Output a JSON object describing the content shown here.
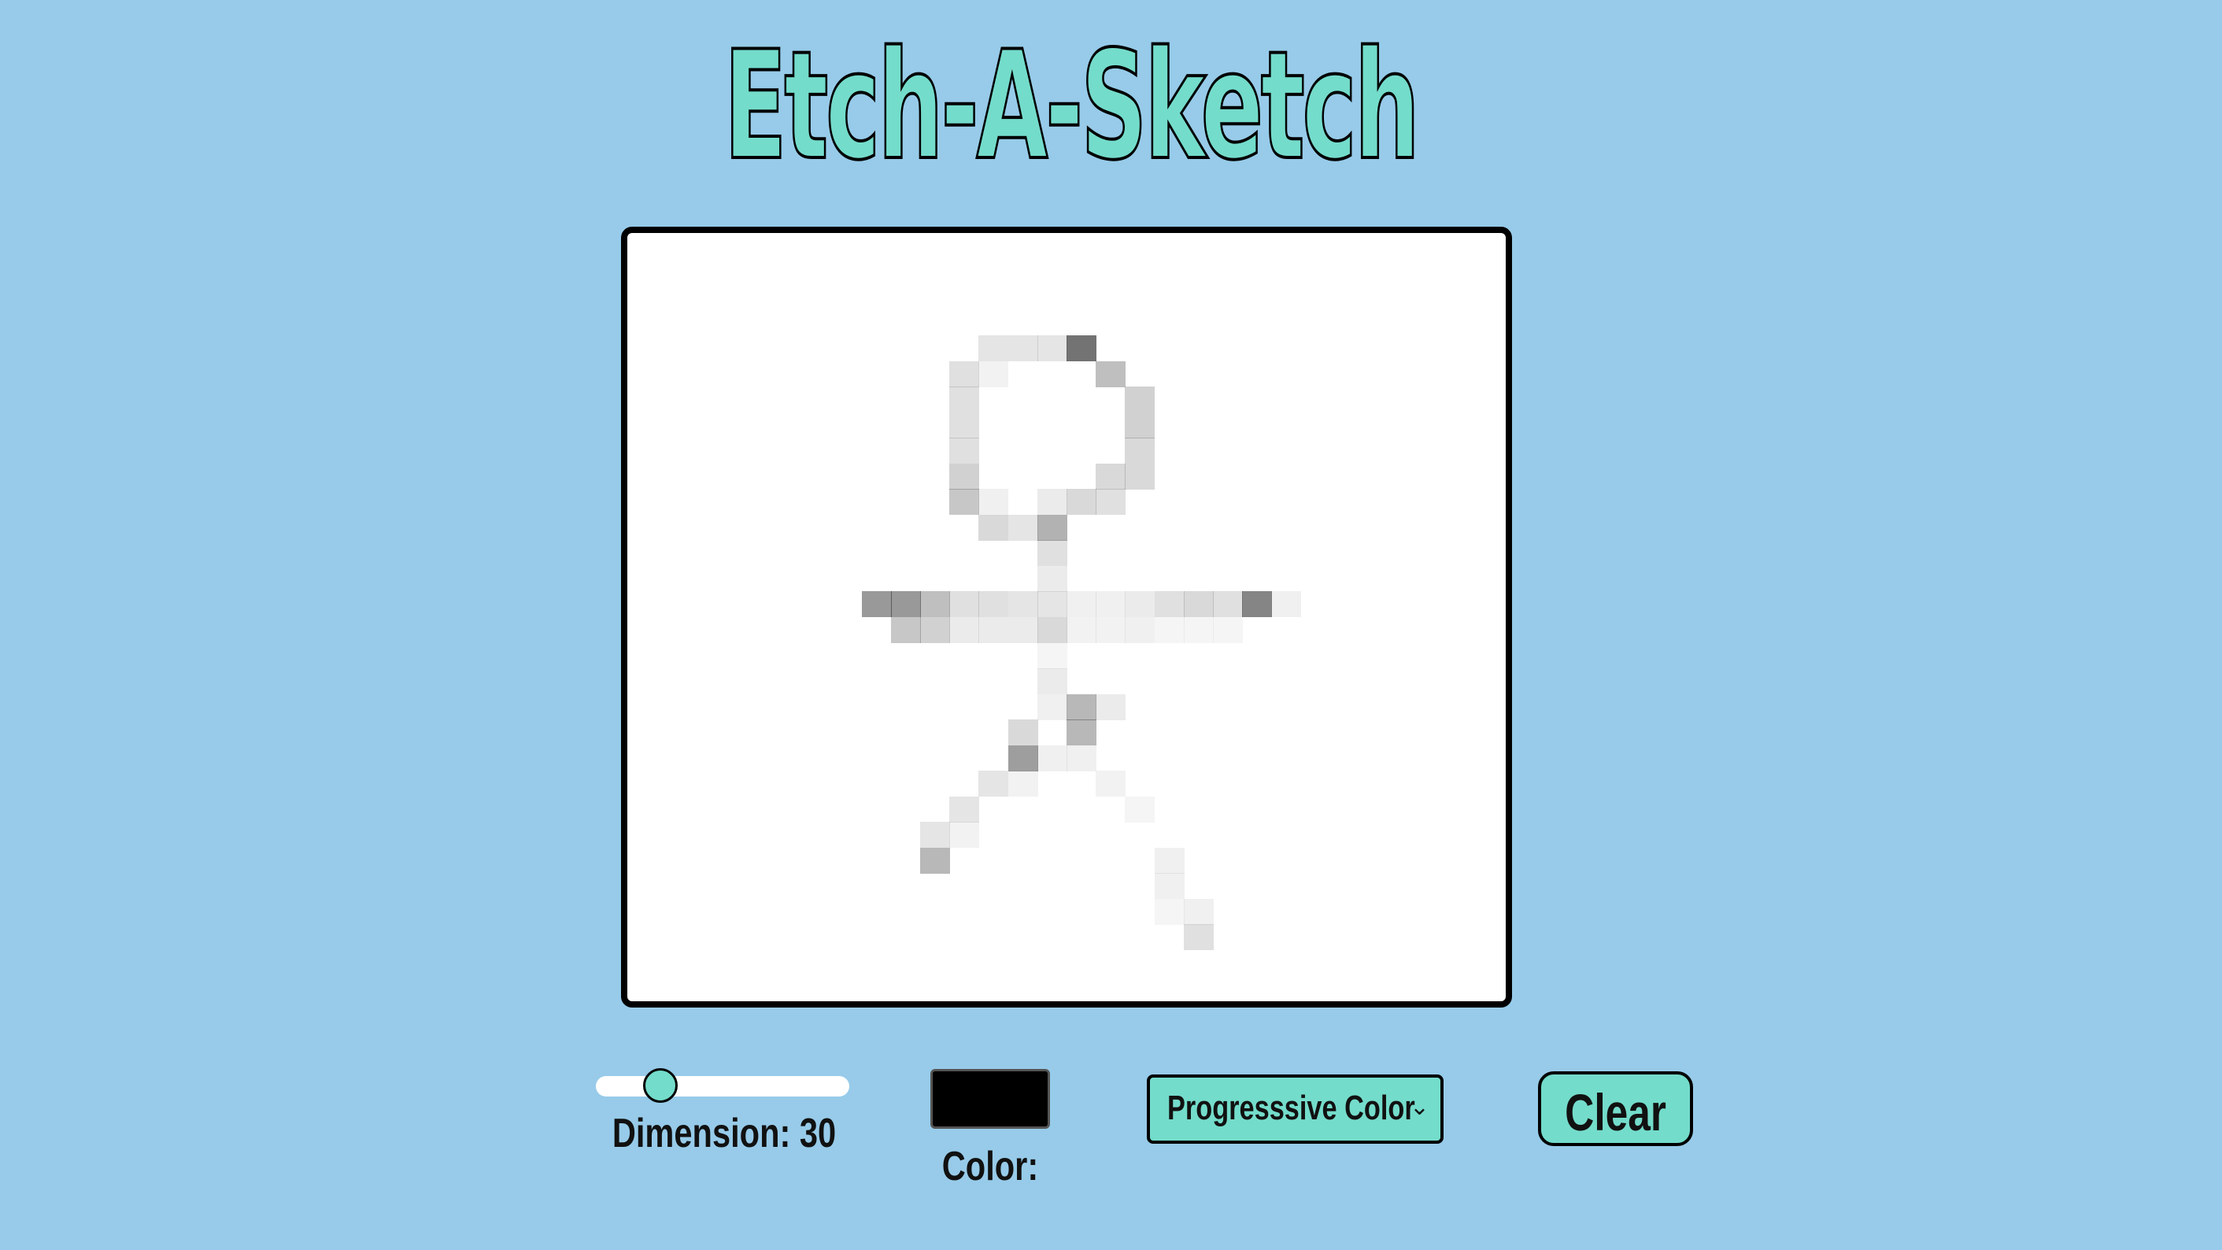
{
  "app": {
    "title": "Etch-A-Sketch"
  },
  "controls": {
    "dimension_label": "Dimension: 30",
    "dimension_value": 30,
    "color_label": "Color:",
    "color_value": "#000000",
    "mode_selected": "Progresssive Color",
    "clear_label": "Clear"
  },
  "colors": {
    "background": "#97cbe9",
    "accent": "#74dccb",
    "board": "#ffffff",
    "outline": "#000000"
  },
  "grid": {
    "size": 30,
    "shaded_cells": [
      [
        12,
        4,
        0.1
      ],
      [
        13,
        4,
        0.1
      ],
      [
        14,
        4,
        0.1
      ],
      [
        15,
        4,
        0.55
      ],
      [
        11,
        5,
        0.12
      ],
      [
        12,
        5,
        0.05
      ],
      [
        16,
        5,
        0.25
      ],
      [
        11,
        6,
        0.12
      ],
      [
        17,
        6,
        0.18
      ],
      [
        11,
        7,
        0.12
      ],
      [
        17,
        7,
        0.18
      ],
      [
        11,
        8,
        0.12
      ],
      [
        17,
        8,
        0.15
      ],
      [
        11,
        9,
        0.18
      ],
      [
        16,
        9,
        0.15
      ],
      [
        17,
        9,
        0.15
      ],
      [
        11,
        10,
        0.22
      ],
      [
        12,
        10,
        0.06
      ],
      [
        14,
        10,
        0.08
      ],
      [
        15,
        10,
        0.15
      ],
      [
        16,
        10,
        0.12
      ],
      [
        12,
        11,
        0.15
      ],
      [
        13,
        11,
        0.1
      ],
      [
        14,
        11,
        0.3
      ],
      [
        14,
        12,
        0.12
      ],
      [
        14,
        13,
        0.08
      ],
      [
        8,
        14,
        0.4
      ],
      [
        9,
        14,
        0.4
      ],
      [
        10,
        14,
        0.25
      ],
      [
        11,
        14,
        0.12
      ],
      [
        12,
        14,
        0.12
      ],
      [
        13,
        14,
        0.1
      ],
      [
        14,
        14,
        0.1
      ],
      [
        15,
        14,
        0.06
      ],
      [
        16,
        14,
        0.06
      ],
      [
        17,
        14,
        0.08
      ],
      [
        18,
        14,
        0.12
      ],
      [
        19,
        14,
        0.15
      ],
      [
        20,
        14,
        0.12
      ],
      [
        21,
        14,
        0.48
      ],
      [
        22,
        14,
        0.06
      ],
      [
        9,
        15,
        0.22
      ],
      [
        10,
        15,
        0.18
      ],
      [
        11,
        15,
        0.08
      ],
      [
        12,
        15,
        0.08
      ],
      [
        13,
        15,
        0.08
      ],
      [
        14,
        15,
        0.15
      ],
      [
        15,
        15,
        0.05
      ],
      [
        16,
        15,
        0.05
      ],
      [
        17,
        15,
        0.06
      ],
      [
        18,
        15,
        0.04
      ],
      [
        19,
        15,
        0.04
      ],
      [
        20,
        15,
        0.04
      ],
      [
        14,
        16,
        0.04
      ],
      [
        14,
        17,
        0.08
      ],
      [
        14,
        18,
        0.06
      ],
      [
        15,
        18,
        0.28
      ],
      [
        16,
        18,
        0.08
      ],
      [
        13,
        19,
        0.15
      ],
      [
        15,
        19,
        0.28
      ],
      [
        13,
        20,
        0.38
      ],
      [
        14,
        20,
        0.06
      ],
      [
        15,
        20,
        0.06
      ],
      [
        12,
        21,
        0.1
      ],
      [
        13,
        21,
        0.05
      ],
      [
        16,
        21,
        0.05
      ],
      [
        11,
        22,
        0.1
      ],
      [
        17,
        22,
        0.04
      ],
      [
        10,
        23,
        0.1
      ],
      [
        11,
        23,
        0.05
      ],
      [
        10,
        24,
        0.28
      ],
      [
        18,
        24,
        0.06
      ],
      [
        18,
        25,
        0.06
      ],
      [
        18,
        26,
        0.04
      ],
      [
        19,
        26,
        0.06
      ],
      [
        19,
        27,
        0.12
      ]
    ]
  }
}
